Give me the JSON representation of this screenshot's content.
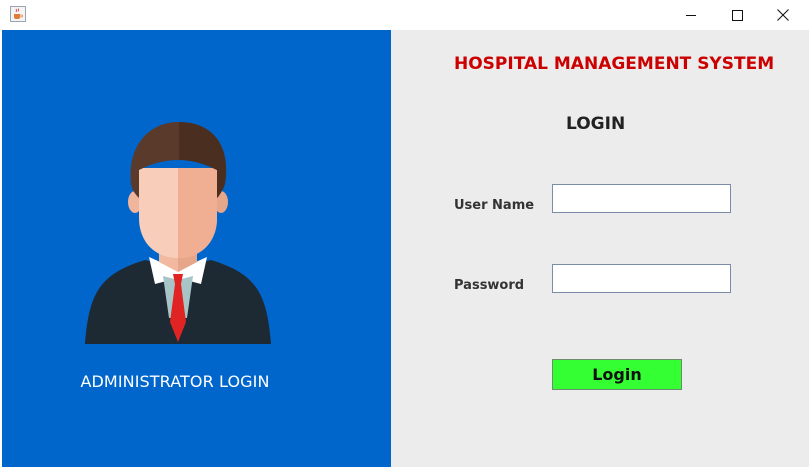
{
  "window": {
    "icon": "java-cup-icon",
    "controls": {
      "minimize": "minimize-icon",
      "maximize": "maximize-icon",
      "close": "close-icon"
    }
  },
  "left_panel": {
    "background": "#0066cc",
    "avatar": "administrator-avatar-icon",
    "label": "ADMINISTRATOR LOGIN"
  },
  "right_panel": {
    "background": "#ececec",
    "title": "HOSPITAL MANAGEMENT SYSTEM",
    "title_color": "#cc0000",
    "heading": "LOGIN",
    "username_label": "User Name",
    "username_value": "",
    "password_label": "Password",
    "password_value": "",
    "login_button": "Login",
    "login_button_color": "#33ff33"
  }
}
